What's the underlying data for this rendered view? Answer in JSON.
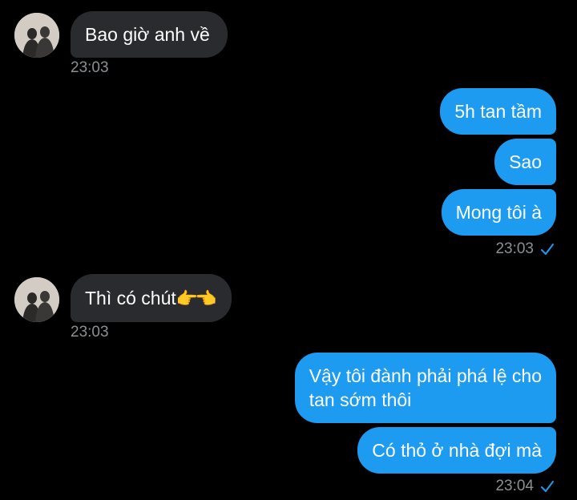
{
  "colors": {
    "background": "#000000",
    "incoming_bubble": "#2a2b2e",
    "outgoing_bubble": "#1d9bf0",
    "timestamp": "#8b8f94",
    "read_check": "#1d9bf0"
  },
  "messages": [
    {
      "direction": "incoming",
      "text": "Bao giờ anh về",
      "time": "23:03"
    },
    {
      "direction": "outgoing",
      "text": "5h tan tầm"
    },
    {
      "direction": "outgoing",
      "text": "Sao"
    },
    {
      "direction": "outgoing",
      "text": "Mong tôi à",
      "time": "23:03",
      "status_icon": "check-icon"
    },
    {
      "direction": "incoming",
      "text": "Thì có chút",
      "emoji": "👉👈",
      "time": "23:03"
    },
    {
      "direction": "outgoing",
      "lines": [
        "Vậy tôi đành phải phá lệ cho",
        "tan sớm thôi"
      ]
    },
    {
      "direction": "outgoing",
      "text": "Có thỏ ở nhà đợi mà",
      "time": "23:04",
      "status_icon": "check-icon"
    }
  ]
}
